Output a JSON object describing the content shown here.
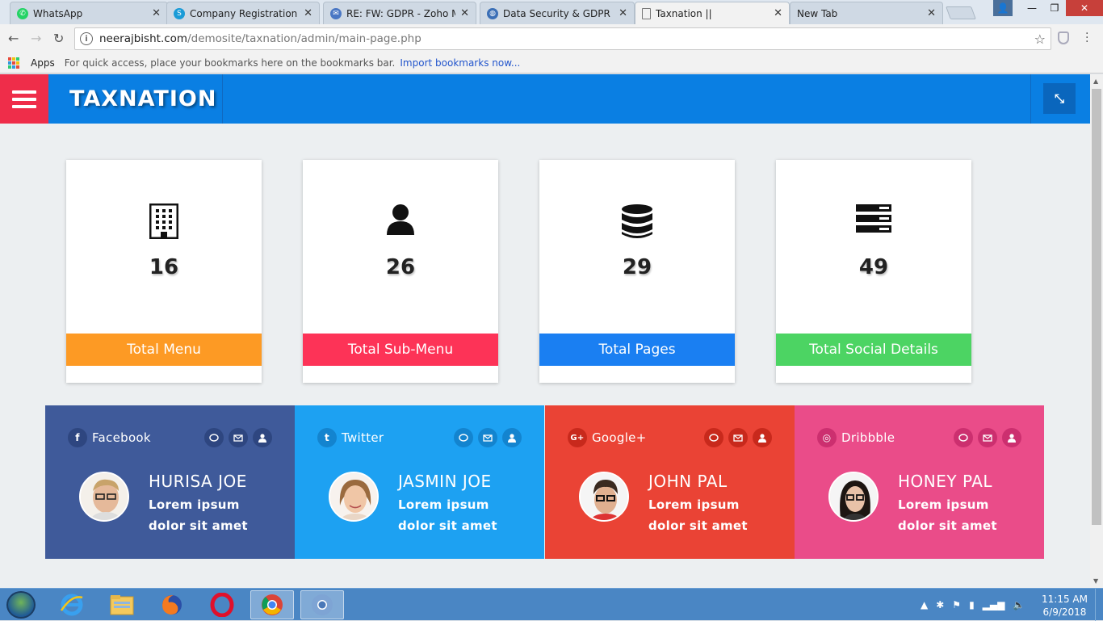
{
  "browser": {
    "tabs": [
      {
        "label": "WhatsApp",
        "icon": "whatsapp-icon",
        "color": "#25d366"
      },
      {
        "label": "Company Registration | T",
        "icon": "company-icon",
        "color": "#1a9bd7"
      },
      {
        "label": "RE: FW: GDPR - Zoho Ma",
        "icon": "mail-icon",
        "color": "#4a77c4"
      },
      {
        "label": "Data Security & GDPR – A",
        "icon": "globe-icon",
        "color": "#3b6fb6"
      },
      {
        "label": "Taxnation ||",
        "icon": "page-icon",
        "color": "#888888"
      },
      {
        "label": "New Tab",
        "icon": "none",
        "color": "#888888"
      }
    ],
    "url_host": "neerajbisht.com",
    "url_path": "/demosite/taxnation/admin/main-page.php",
    "bookmarks": {
      "apps_label": "Apps",
      "hint": "For quick access, place your bookmarks here on the bookmarks bar.",
      "import_link": "Import bookmarks now..."
    }
  },
  "app": {
    "brand": "TAXNATION",
    "colors": {
      "header": "#0a7fe3",
      "menu": "#ef2d4a"
    }
  },
  "stats": [
    {
      "icon": "building-icon",
      "value": "16",
      "label": "Total Menu",
      "color": "#fd9a24"
    },
    {
      "icon": "user-icon",
      "value": "26",
      "label": "Total Sub-Menu",
      "color": "#fd3357"
    },
    {
      "icon": "database-icon",
      "value": "29",
      "label": "Total Pages",
      "color": "#1a7ff2"
    },
    {
      "icon": "server-icon",
      "value": "49",
      "label": "Total Social Details",
      "color": "#4cd463"
    }
  ],
  "social": [
    {
      "network": "Facebook",
      "glyph": "f",
      "name": "HURISA JOE",
      "line1": "Lorem ipsum",
      "line2": "dolor sit amet",
      "color": "#3f5a9a",
      "dark": "#2e4680"
    },
    {
      "network": "Twitter",
      "glyph": "t",
      "name": "JASMIN JOE",
      "line1": "Lorem ipsum",
      "line2": "dolor sit amet",
      "color": "#1da1f2",
      "dark": "#1384cf"
    },
    {
      "network": "Google+",
      "glyph": "G+",
      "name": "JOHN PAL",
      "line1": "Lorem ipsum",
      "line2": "dolor sit amet",
      "color": "#ea4335",
      "dark": "#c8291c"
    },
    {
      "network": "Dribbble",
      "glyph": "◎",
      "name": "HONEY PAL",
      "line1": "Lorem ipsum",
      "line2": "dolor sit amet",
      "color": "#ea4c89",
      "dark": "#cc2f6f"
    }
  ],
  "taskbar": {
    "time": "11:15 AM",
    "date": "6/9/2018"
  }
}
